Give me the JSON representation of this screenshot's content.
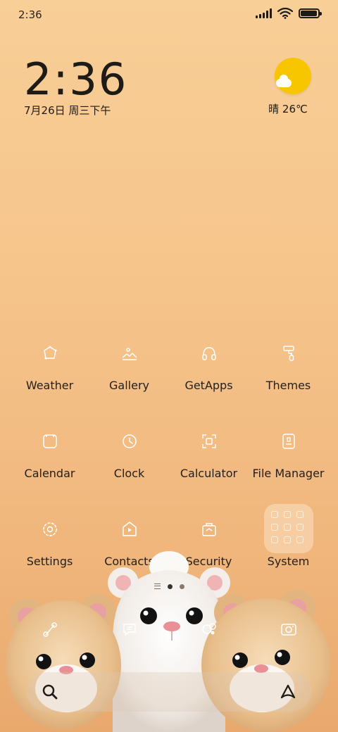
{
  "status_bar": {
    "time": "2:36",
    "signal_icon": "signal-icon",
    "wifi_icon": "wifi-icon",
    "battery_icon": "battery-icon",
    "battery_level": 0.95
  },
  "clock_widget": {
    "time": "2:36",
    "date": "7月26日 周三下午"
  },
  "weather_widget": {
    "icon": "sun-cloud-icon",
    "text": "晴 26℃",
    "sun_color": "#f7c600"
  },
  "apps": [
    {
      "label": "Weather",
      "icon": "weather-icon"
    },
    {
      "label": "Gallery",
      "icon": "gallery-icon"
    },
    {
      "label": "GetApps",
      "icon": "getapps-icon"
    },
    {
      "label": "Themes",
      "icon": "themes-icon"
    },
    {
      "label": "Calendar",
      "icon": "calendar-icon"
    },
    {
      "label": "Clock",
      "icon": "clock-icon"
    },
    {
      "label": "Calculator",
      "icon": "calculator-icon"
    },
    {
      "label": "File Manager",
      "icon": "file-manager-icon"
    },
    {
      "label": "Settings",
      "icon": "settings-icon"
    },
    {
      "label": "Contacts",
      "icon": "contacts-icon"
    },
    {
      "label": "Security",
      "icon": "security-icon"
    },
    {
      "label": "System",
      "icon": "folder-icon"
    }
  ],
  "page_indicator": {
    "pages": 2,
    "active": 1
  },
  "dock": [
    {
      "icon": "phone-icon"
    },
    {
      "icon": "messages-icon"
    },
    {
      "icon": "browser-icon"
    },
    {
      "icon": "camera-icon"
    }
  ],
  "search_bar": {
    "search_icon": "search-icon",
    "assistant_icon": "assistant-icon"
  },
  "wallpaper": "bears-wallpaper"
}
